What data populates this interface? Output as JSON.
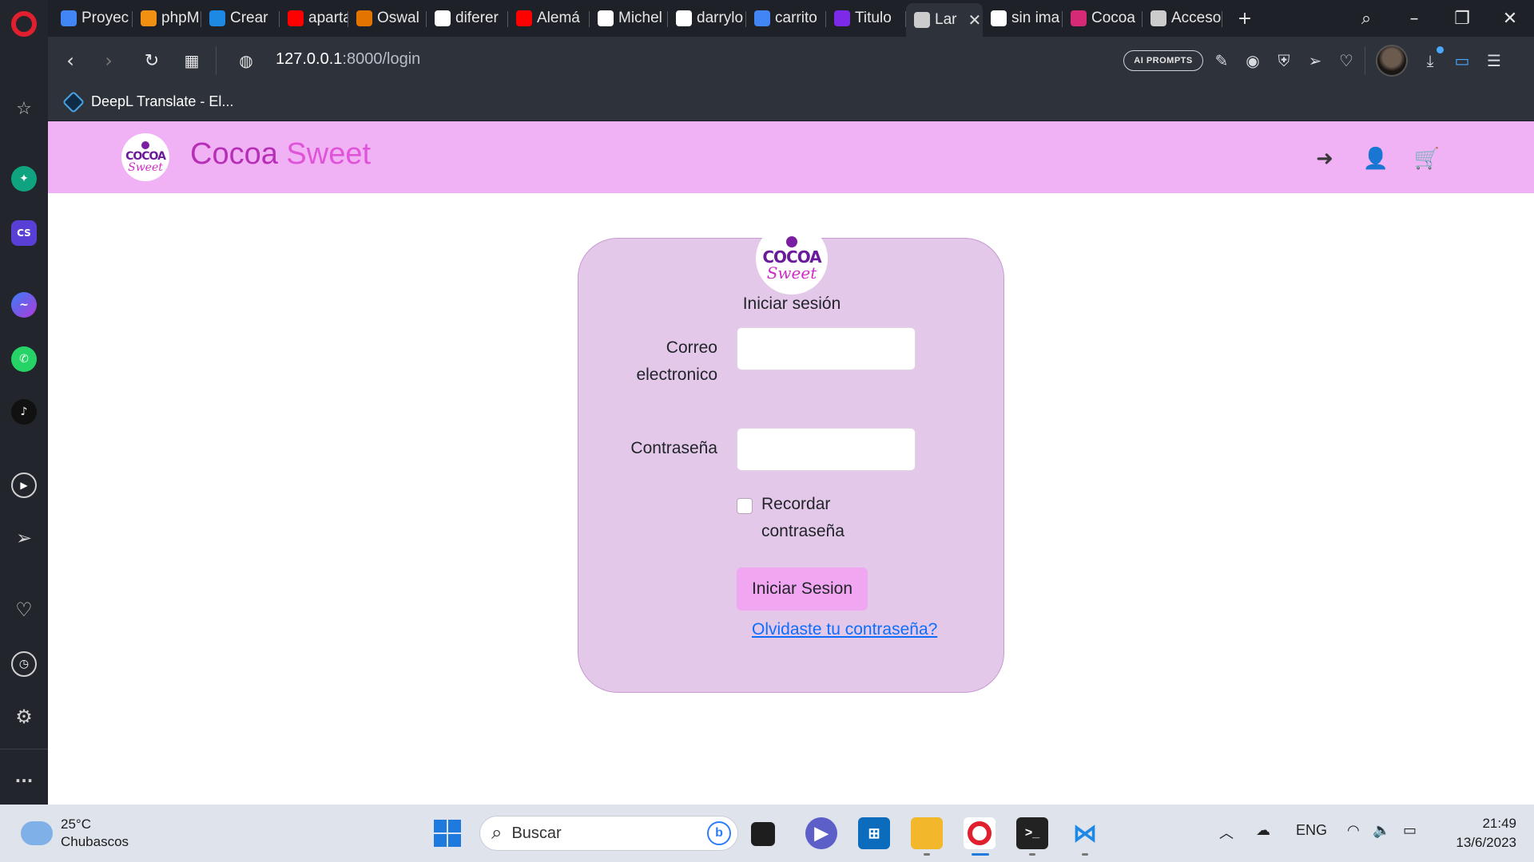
{
  "browser": {
    "tabs": [
      {
        "title": "Proyec",
        "icon": "docs-icon",
        "color": "#4285f4"
      },
      {
        "title": "phpM",
        "icon": "phpmyadmin-icon",
        "color": "#f29111"
      },
      {
        "title": "Crear",
        "icon": "arch-icon",
        "color": "#1e88e5"
      },
      {
        "title": "aparta",
        "icon": "youtube-icon",
        "color": "#ff0000"
      },
      {
        "title": "Oswal",
        "icon": "colorful-app-icon",
        "color": "#e37400"
      },
      {
        "title": "diferer",
        "icon": "google-icon",
        "color": "#ffffff"
      },
      {
        "title": "Alemá",
        "icon": "youtube-icon",
        "color": "#ff0000"
      },
      {
        "title": "Michel",
        "icon": "github-icon",
        "color": "#ffffff"
      },
      {
        "title": "darrylo",
        "icon": "github-icon",
        "color": "#ffffff"
      },
      {
        "title": "carrito",
        "icon": "docs-icon",
        "color": "#4285f4"
      },
      {
        "title": "Titulo",
        "icon": "canva-icon",
        "color": "#7d2ae8"
      },
      {
        "title": "Lar",
        "icon": "globe-icon",
        "color": "#cccccc",
        "active": true
      },
      {
        "title": "sin ima",
        "icon": "google-icon",
        "color": "#ffffff"
      },
      {
        "title": "Cocoa",
        "icon": "instagram-icon",
        "color": "#d62976"
      },
      {
        "title": "Acceso",
        "icon": "grid-icon",
        "color": "#cccccc"
      }
    ],
    "new_tab_label": "+",
    "url_host": "127.0.0.1",
    "url_path": ":8000/login",
    "ai_prompts_label": "AI PROMPTS",
    "bookmark": "DeepL Translate - El..."
  },
  "site": {
    "brand_part1": "Cocoa",
    "brand_part2": "Sweet",
    "logo_top": "COCOA",
    "logo_bottom": "Sweet",
    "nav_colors": {
      "header_bg": "#f0b2f5",
      "card_bg": "#e4c8ea",
      "button_bg": "#f0a6f0",
      "link": "#0d6efd"
    }
  },
  "login": {
    "title": "Iniciar sesión",
    "email_label": "Correo electronico",
    "email_value": "",
    "password_label": "Contraseña",
    "password_value": "",
    "remember_label": "Recordar contraseña",
    "remember_checked": false,
    "submit_label": "Iniciar Sesion",
    "forgot_label": "Olvidaste tu contraseña?"
  },
  "taskbar": {
    "temperature": "25°C",
    "weather": "Chubascos",
    "search_placeholder": "Buscar",
    "language": "ENG",
    "time": "21:49",
    "date": "13/6/2023"
  }
}
